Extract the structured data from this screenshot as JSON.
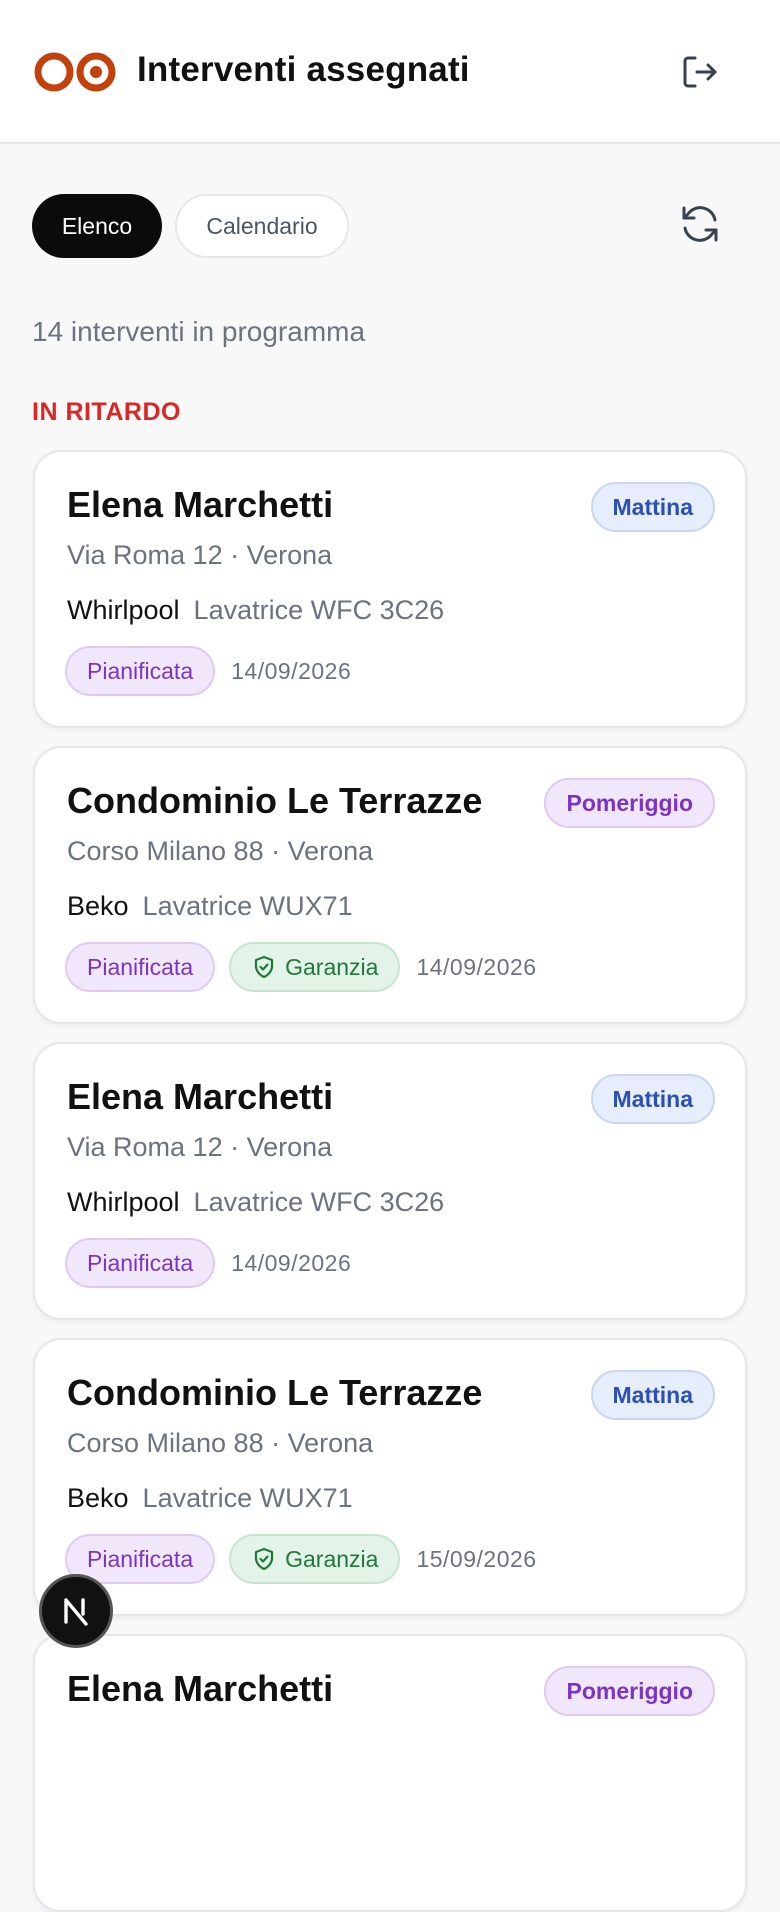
{
  "header": {
    "title": "Interventi assegnati",
    "logo_icon": "brand-logo-icon",
    "logout_icon": "logout-icon",
    "accent_color": "#c2410c"
  },
  "tabs": [
    {
      "label": "Elenco",
      "active": true
    },
    {
      "label": "Calendario",
      "active": false
    }
  ],
  "refresh_icon": "refresh-icon",
  "count_text": "14 interventi in programma",
  "section_title": "IN RITARDO",
  "cards": [
    {
      "name": "Elena Marchetti",
      "address": "Via Roma 12 · Verona",
      "brand": "Whirlpool",
      "model": "Lavatrice WFC 3C26",
      "slot": "Mattina",
      "status": "Pianificata",
      "warranty": "",
      "date": "14/09/2026"
    },
    {
      "name": "Condominio Le Terrazze",
      "address": "Corso Milano 88 · Verona",
      "brand": "Beko",
      "model": "Lavatrice WUX71",
      "slot": "Pomeriggio",
      "status": "Pianificata",
      "warranty": "Garanzia",
      "date": "14/09/2026"
    },
    {
      "name": "Elena Marchetti",
      "address": "Via Roma 12 · Verona",
      "brand": "Whirlpool",
      "model": "Lavatrice WFC 3C26",
      "slot": "Mattina",
      "status": "Pianificata",
      "warranty": "",
      "date": "14/09/2026"
    },
    {
      "name": "Condominio Le Terrazze",
      "address": "Corso Milano 88 · Verona",
      "brand": "Beko",
      "model": "Lavatrice WUX71",
      "slot": "Mattina",
      "status": "Pianificata",
      "warranty": "Garanzia",
      "date": "15/09/2026"
    },
    {
      "name": "Elena Marchetti",
      "slot": "Pomeriggio"
    }
  ],
  "dev_badge": {
    "letter": "N"
  }
}
